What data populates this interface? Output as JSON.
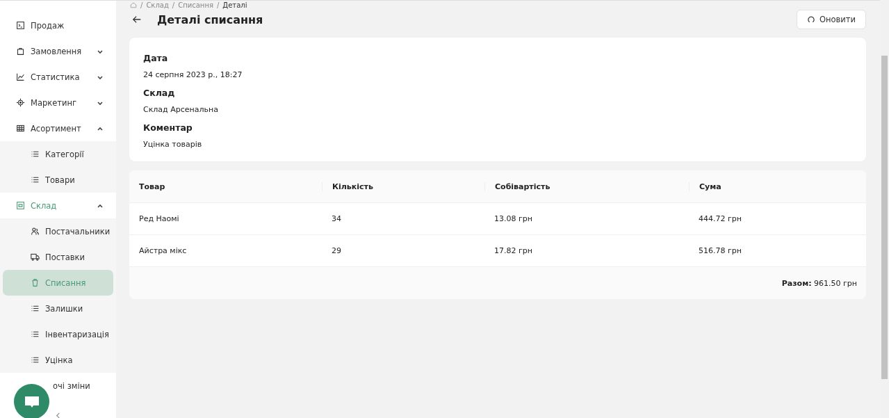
{
  "sidebar": {
    "items": [
      {
        "label": "Продаж",
        "selected": false
      },
      {
        "label": "Замовлення",
        "expanded": false,
        "selected": false
      },
      {
        "label": "Статистика",
        "expanded": false,
        "selected": false
      },
      {
        "label": "Маркетинг",
        "expanded": false,
        "selected": false
      },
      {
        "label": "Асортимент",
        "expanded": true,
        "selected": false,
        "children": [
          {
            "label": "Категорії",
            "selected": false
          },
          {
            "label": "Товари",
            "selected": false
          }
        ]
      },
      {
        "label": "Склад",
        "expanded": true,
        "selected": true,
        "children": [
          {
            "label": "Постачальники",
            "selected": false
          },
          {
            "label": "Поставки",
            "selected": false
          },
          {
            "label": "Списання",
            "selected": true
          },
          {
            "label": "Залишки",
            "selected": false
          },
          {
            "label": "Інвентаризація",
            "selected": false
          },
          {
            "label": "Уцінка",
            "selected": false
          }
        ]
      },
      {
        "label": "очі зміни",
        "selected": false
      }
    ]
  },
  "breadcrumb": {
    "separator": "/",
    "items": [
      "Склад",
      "Списання",
      "Деталі"
    ]
  },
  "page": {
    "title": "Деталі списання",
    "refresh_button": "Оновити"
  },
  "details": [
    {
      "label": "Дата",
      "value": "24 серпня 2023 р., 18:27"
    },
    {
      "label": "Склад",
      "value": "Склад Арсенальна"
    },
    {
      "label": "Коментар",
      "value": "Уцінка товарів"
    }
  ],
  "table": {
    "columns": [
      "Товар",
      "Кількість",
      "Собівартість",
      "Сума"
    ],
    "rows": [
      [
        "Ред Наомі",
        "34",
        "13.08 грн",
        "444.72 грн"
      ],
      [
        "Айстра мікс",
        "29",
        "17.82 грн",
        "516.78 грн"
      ]
    ],
    "total": "**Разом:** 961.50 грн"
  }
}
